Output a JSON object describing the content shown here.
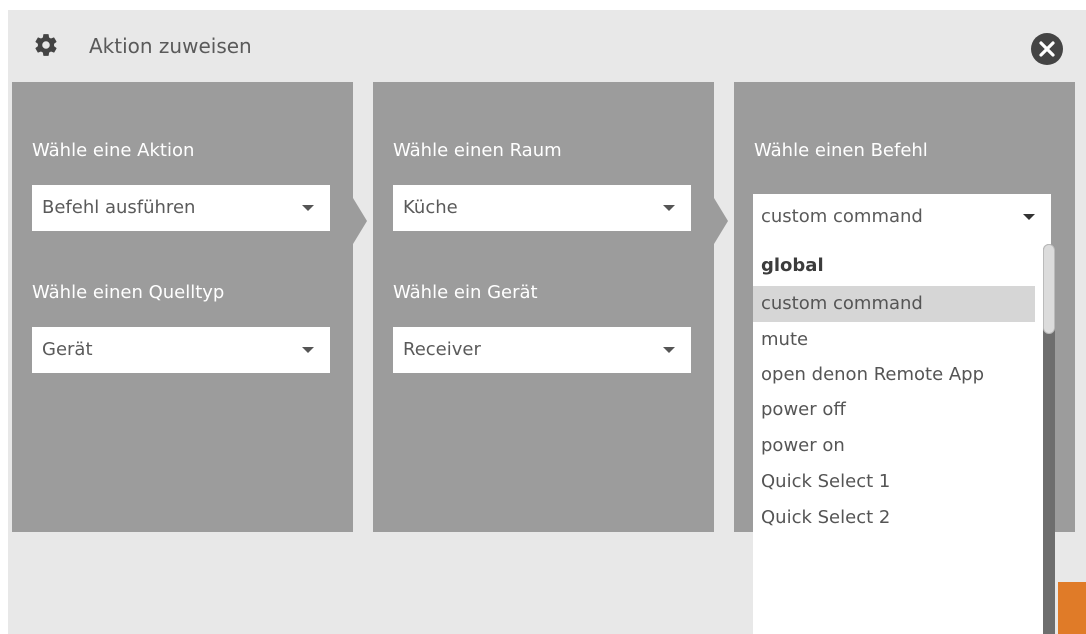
{
  "dialog": {
    "title": "Aktion zuweisen",
    "icon": "gear-icon",
    "close_icon": "close-icon"
  },
  "panels": [
    {
      "label1": "Wähle eine Aktion",
      "select1": "Befehl ausführen",
      "label2": "Wähle einen Quelltyp",
      "select2": "Gerät"
    },
    {
      "label1": "Wähle einen Raum",
      "select1": "Küche",
      "label2": "Wähle ein Gerät",
      "select2": "Receiver"
    },
    {
      "label1": "Wähle einen Befehl",
      "select1": "custom command"
    }
  ],
  "dropdown": {
    "group": "global",
    "options": [
      "custom command",
      "mute",
      "open denon Remote App",
      "power off",
      "power on",
      "Quick Select 1",
      "Quick Select 2"
    ],
    "highlighted": "custom command"
  },
  "colors": {
    "panel": "#9c9c9c",
    "dialog_bg": "#e8e8e8",
    "accent": "#e07b28"
  }
}
